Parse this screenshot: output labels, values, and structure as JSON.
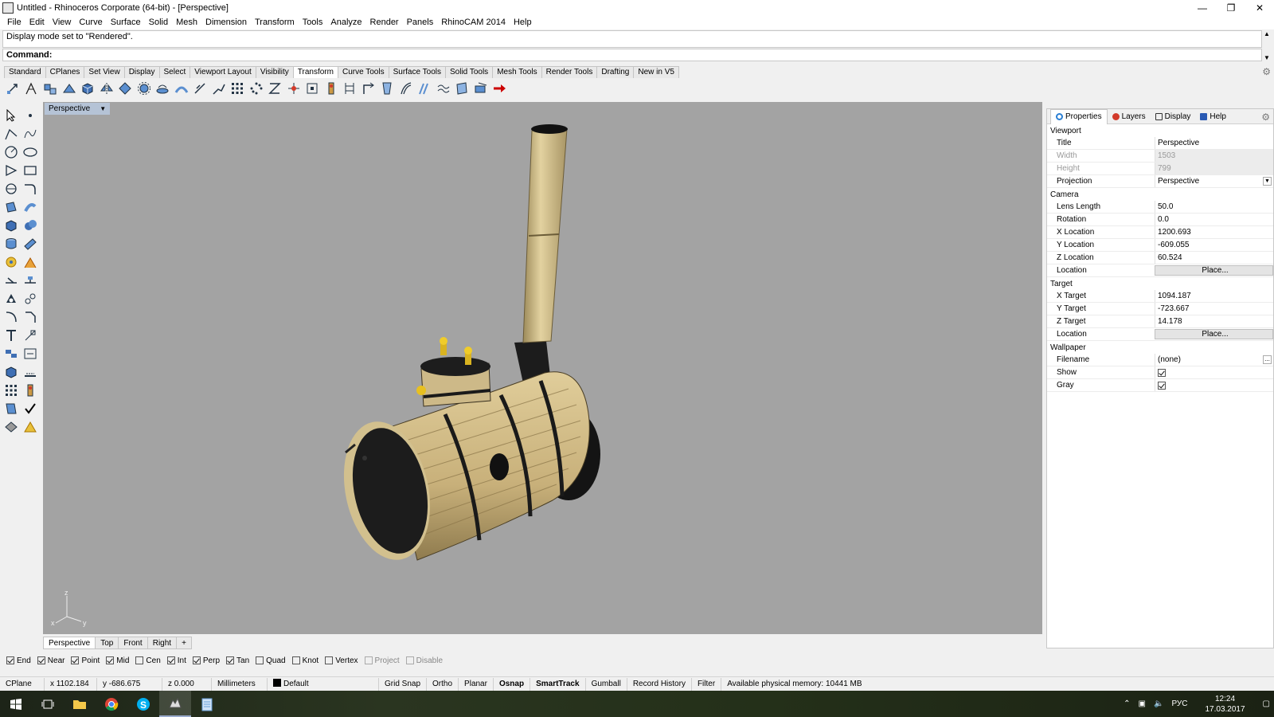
{
  "window": {
    "title": "Untitled - Rhinoceros Corporate (64-bit) - [Perspective]"
  },
  "menu": [
    "File",
    "Edit",
    "View",
    "Curve",
    "Surface",
    "Solid",
    "Mesh",
    "Dimension",
    "Transform",
    "Tools",
    "Analyze",
    "Render",
    "Panels",
    "RhinoCAM 2014",
    "Help"
  ],
  "command": {
    "history": "Display mode set to \"Rendered\".",
    "prompt": "Command:"
  },
  "toolbar_tabs": [
    "Standard",
    "CPlanes",
    "Set View",
    "Display",
    "Select",
    "Viewport Layout",
    "Visibility",
    "Transform",
    "Curve Tools",
    "Surface Tools",
    "Solid Tools",
    "Mesh Tools",
    "Render Tools",
    "Drafting",
    "New in V5"
  ],
  "active_toolbar_tab": "Transform",
  "viewport": {
    "title": "Perspective",
    "axis": {
      "z": "z",
      "x": "x",
      "y": "y"
    }
  },
  "viewport_tabs": [
    "Perspective",
    "Top",
    "Front",
    "Right",
    "+"
  ],
  "panel": {
    "tabs": [
      {
        "label": "Properties",
        "icon": "properties-icon",
        "color": "#2a7fd4"
      },
      {
        "label": "Layers",
        "icon": "layers-icon",
        "color": "#d23a2a"
      },
      {
        "label": "Display",
        "icon": "display-icon",
        "color": "#333333"
      },
      {
        "label": "Help",
        "icon": "help-icon",
        "color": "#2a5ab4"
      }
    ],
    "sections": {
      "viewport": "Viewport",
      "camera": "Camera",
      "target": "Target",
      "wallpaper": "Wallpaper"
    },
    "viewport_props": {
      "title": {
        "k": "Title",
        "v": "Perspective"
      },
      "width": {
        "k": "Width",
        "v": "1503"
      },
      "height": {
        "k": "Height",
        "v": "799"
      },
      "projection": {
        "k": "Projection",
        "v": "Perspective"
      }
    },
    "camera_props": {
      "lens": {
        "k": "Lens Length",
        "v": "50.0"
      },
      "rotation": {
        "k": "Rotation",
        "v": "0.0"
      },
      "xloc": {
        "k": "X Location",
        "v": "1200.693"
      },
      "yloc": {
        "k": "Y Location",
        "v": "-609.055"
      },
      "zloc": {
        "k": "Z Location",
        "v": "60.524"
      },
      "location": {
        "k": "Location",
        "v": "Place..."
      }
    },
    "target_props": {
      "xt": {
        "k": "X Target",
        "v": "1094.187"
      },
      "yt": {
        "k": "Y Target",
        "v": "-723.667"
      },
      "zt": {
        "k": "Z Target",
        "v": "14.178"
      },
      "location": {
        "k": "Location",
        "v": "Place..."
      }
    },
    "wallpaper_props": {
      "filename": {
        "k": "Filename",
        "v": "(none)",
        "btn": "..."
      },
      "show": {
        "k": "Show",
        "checked": true
      },
      "gray": {
        "k": "Gray",
        "checked": true
      }
    }
  },
  "osnaps": [
    {
      "label": "End",
      "checked": true
    },
    {
      "label": "Near",
      "checked": true
    },
    {
      "label": "Point",
      "checked": true
    },
    {
      "label": "Mid",
      "checked": true
    },
    {
      "label": "Cen",
      "checked": false
    },
    {
      "label": "Int",
      "checked": true
    },
    {
      "label": "Perp",
      "checked": true
    },
    {
      "label": "Tan",
      "checked": true
    },
    {
      "label": "Quad",
      "checked": false
    },
    {
      "label": "Knot",
      "checked": false
    },
    {
      "label": "Vertex",
      "checked": false
    },
    {
      "label": "Project",
      "checked": false,
      "disabled": true
    },
    {
      "label": "Disable",
      "checked": false,
      "disabled": true
    }
  ],
  "status": {
    "cplane": "CPlane",
    "x": "x 1102.184",
    "y": "y -686.675",
    "z": "z 0.000",
    "units": "Millimeters",
    "layer": "Default",
    "grid_snap": "Grid Snap",
    "ortho": "Ortho",
    "planar": "Planar",
    "osnap": "Osnap",
    "smarttrack": "SmartTrack",
    "gumball": "Gumball",
    "record_history": "Record History",
    "filter": "Filter",
    "memory": "Available physical memory: 10441 MB"
  },
  "taskbar": {
    "lang": "РУС",
    "time": "12:24",
    "date": "17.03.2017"
  }
}
